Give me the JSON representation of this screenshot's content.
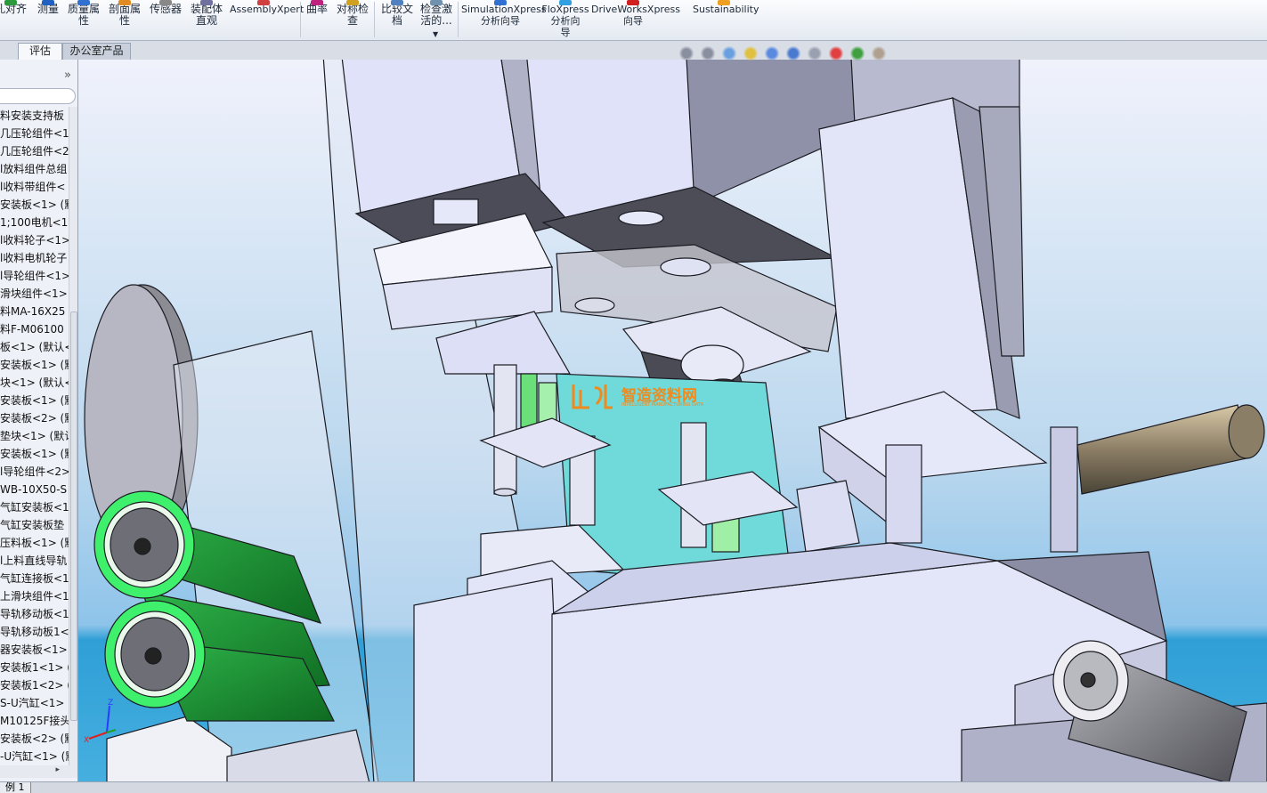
{
  "ribbon": {
    "buttons": [
      {
        "label": "孔对齐"
      },
      {
        "label": "测量"
      },
      {
        "label": "质量属\n性"
      },
      {
        "label": "剖面属\n性"
      },
      {
        "label": "传感器"
      },
      {
        "label": "装配体\n直观"
      },
      {
        "label": "AssemblyXpert"
      },
      {
        "label": "曲率"
      },
      {
        "label": "对称检\n查"
      },
      {
        "label": "比较文\n档"
      },
      {
        "label": "检查激\n活的..."
      },
      {
        "label": "SimulationXpress\n分析向导"
      },
      {
        "label": "FloXpress\n分析向\n导"
      },
      {
        "label": "DriveWorksXpress\n向导"
      },
      {
        "label": "Sustainability"
      }
    ]
  },
  "tabs": [
    {
      "label": "评估",
      "active": true
    },
    {
      "label": "办公室产品",
      "active": false
    }
  ],
  "panel": {
    "collapse_icon": "double-chevron-right-icon",
    "tree_items": [
      "料安装支持板",
      "几压轮组件<1>",
      "几压轮组件<2>",
      "l放料组件总组",
      "l收料带组件<",
      "安装板<1> (默",
      "1;100电机<1",
      "l收料轮子<1>",
      "l收料电机轮子",
      "l导轮组件<1>",
      "滑块组件<1>",
      "料MA-16X25",
      "料F-M06100",
      "板<1> (默认<",
      "安装板<1> (默",
      "块<1> (默认<",
      "安装板<1> (默",
      "安装板<2> (默",
      "垫块<1> (默认",
      "安装板<1> (默",
      "l导轮组件<2>",
      "WB-10X50-S",
      "气缸安装板<1",
      "气缸安装板垫",
      "压料板<1> (默",
      "l上料直线导轨",
      "气缸连接板<1",
      "上滑块组件<1",
      "导轨移动板<1",
      "导轨移动板1<",
      "器安装板<1>",
      "安装板1<1> (",
      "安装板1<2> (",
      "S-U汽缸<1>",
      "M10125F接头",
      "安装板<2> (默",
      "-U汽缸<1> (默"
    ]
  },
  "viewport": {
    "heads_up_icons": [
      "zoom-to-fit-icon",
      "zoom-to-area-icon",
      "previous-view-icon",
      "section-view-icon",
      "view-orientation-icon",
      "display-style-icon",
      "hide-show-items-icon",
      "edit-appearance-icon",
      "apply-scene-icon",
      "view-settings-icon"
    ],
    "watermark": {
      "title": "智造资料网",
      "subtitle": "INTELLIGENT MANUFACTURING DATA"
    },
    "triad": {
      "x": "X",
      "z": "Z"
    },
    "colors": {
      "background_top": "#eef0fb",
      "sea": "#2f9fd6",
      "part": "#dcdff5",
      "part_dark": "#8f91a8",
      "roller": "#1e9a3a",
      "roller_ring": "#3ef06b"
    }
  },
  "status": {
    "tab": "例 1"
  }
}
